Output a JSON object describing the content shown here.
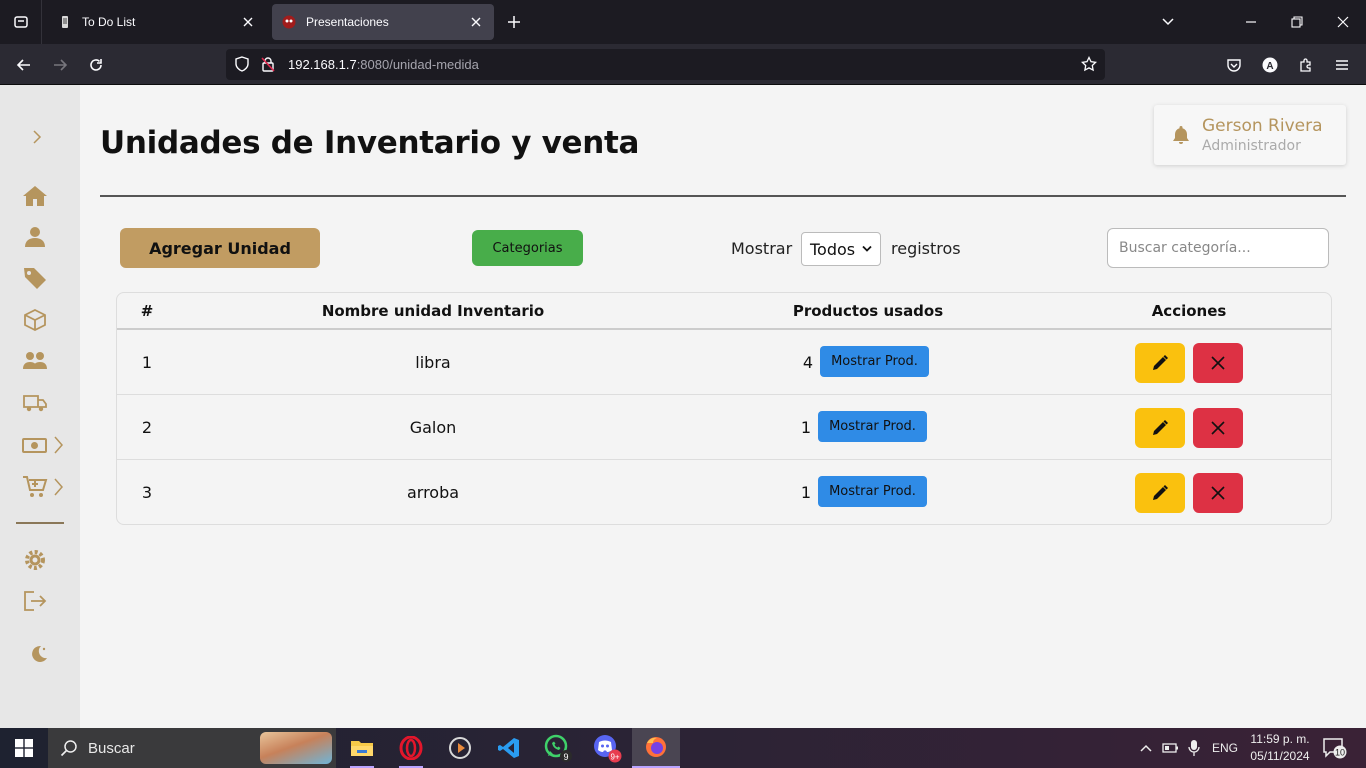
{
  "browser": {
    "tabs": [
      {
        "title": "To Do List",
        "active": false
      },
      {
        "title": "Presentaciones",
        "active": true
      }
    ],
    "url_host": "192.168.1.7",
    "url_rest": ":8080/unidad-medida"
  },
  "page": {
    "title": "Unidades de Inventario y venta",
    "user": {
      "name": "Gerson Rivera",
      "role": "Administrador"
    },
    "buttons": {
      "add": "Agregar Unidad",
      "categories": "Categorias"
    },
    "show": {
      "label_before": "Mostrar",
      "selected": "Todos",
      "label_after": "registros"
    },
    "search": {
      "placeholder": "Buscar categoría..."
    },
    "table": {
      "headers": [
        "#",
        "Nombre unidad Inventario",
        "Productos usados",
        "Acciones"
      ],
      "rows": [
        {
          "num": "1",
          "name": "libra",
          "count": "4",
          "show_label": "Mostrar Prod."
        },
        {
          "num": "2",
          "name": "Galon",
          "count": "1",
          "show_label": "Mostrar Prod."
        },
        {
          "num": "3",
          "name": "arroba",
          "count": "1",
          "show_label": "Mostrar Prod."
        }
      ]
    }
  },
  "sidebar": {
    "icons": [
      "expand-icon",
      "home-icon",
      "user-icon",
      "tag-icon",
      "box-icon",
      "users-icon",
      "truck-icon",
      "cash-icon",
      "cart-icon",
      "gear-icon",
      "logout-icon",
      "moon-icon"
    ]
  },
  "taskbar": {
    "search_label": "Buscar",
    "whatsapp_badge": "9",
    "discord_badge": "9+",
    "lang": "ENG",
    "time": "11:59 p. m.",
    "date": "05/11/2024",
    "notif_count": "10"
  },
  "colors": {
    "accent": "#c19c62",
    "green": "#48ad4a",
    "blue": "#2f8be6",
    "yellow": "#fac10e",
    "red": "#dd3144"
  }
}
